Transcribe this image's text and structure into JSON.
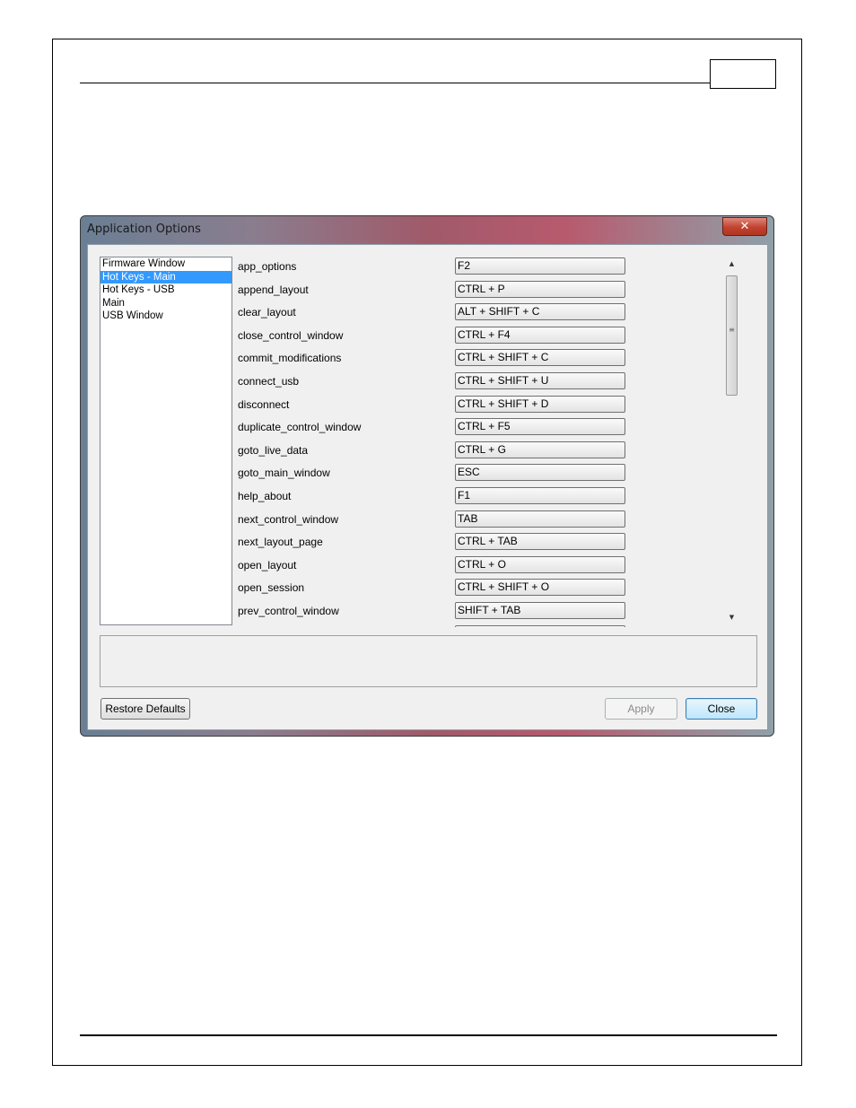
{
  "dialog": {
    "title": "Application Options",
    "close_glyph": "✕"
  },
  "categories": [
    {
      "label": "Firmware Window",
      "selected": false
    },
    {
      "label": "Hot Keys - Main",
      "selected": true
    },
    {
      "label": "Hot Keys - USB",
      "selected": false
    },
    {
      "label": "Main",
      "selected": false
    },
    {
      "label": "USB Window",
      "selected": false
    }
  ],
  "hotkeys": [
    {
      "name": "app_options",
      "keys": "F2"
    },
    {
      "name": "append_layout",
      "keys": "CTRL + P"
    },
    {
      "name": "clear_layout",
      "keys": "ALT + SHIFT + C"
    },
    {
      "name": "close_control_window",
      "keys": "CTRL + F4"
    },
    {
      "name": "commit_modifications",
      "keys": "CTRL + SHIFT + C"
    },
    {
      "name": "connect_usb",
      "keys": "CTRL + SHIFT + U"
    },
    {
      "name": "disconnect",
      "keys": "CTRL + SHIFT + D"
    },
    {
      "name": "duplicate_control_window",
      "keys": "CTRL + F5"
    },
    {
      "name": "goto_live_data",
      "keys": "CTRL + G"
    },
    {
      "name": "goto_main_window",
      "keys": "ESC"
    },
    {
      "name": "help_about",
      "keys": "F1"
    },
    {
      "name": "next_control_window",
      "keys": "TAB"
    },
    {
      "name": "next_layout_page",
      "keys": "CTRL + TAB"
    },
    {
      "name": "open_layout",
      "keys": "CTRL + O"
    },
    {
      "name": "open_session",
      "keys": "CTRL + SHIFT + O"
    },
    {
      "name": "prev_control_window",
      "keys": "SHIFT + TAB"
    }
  ],
  "scrollbar": {
    "up_glyph": "▲",
    "down_glyph": "▼",
    "grip_glyph": "≡"
  },
  "buttons": {
    "restore_defaults": "Restore Defaults",
    "apply": "Apply",
    "close": "Close"
  }
}
